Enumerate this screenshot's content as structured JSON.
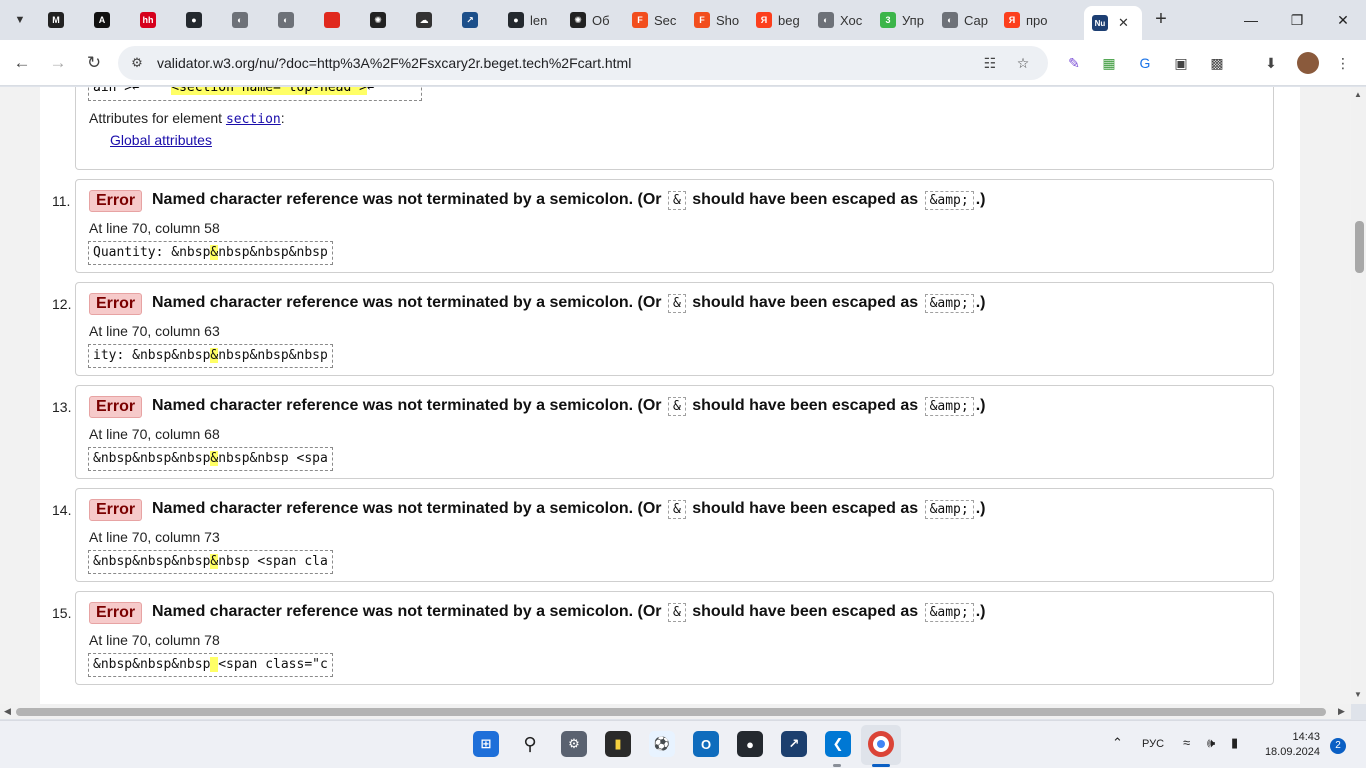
{
  "tabs": [
    {
      "title": "",
      "icon": "m-icon",
      "color": "#222222",
      "glyph": "M"
    },
    {
      "title": "",
      "icon": "a-icon",
      "color": "#111111",
      "glyph": "A"
    },
    {
      "title": "",
      "icon": "hh-icon",
      "color": "#d6001c",
      "glyph": "hh"
    },
    {
      "title": "",
      "icon": "github-icon",
      "color": "#24292f",
      "glyph": "●"
    },
    {
      "title": "",
      "icon": "globe-icon",
      "color": "#6d7178",
      "glyph": "◐"
    },
    {
      "title": "",
      "icon": "globe-icon",
      "color": "#6d7178",
      "glyph": "◐"
    },
    {
      "title": "",
      "icon": "red-square-icon",
      "color": "#e0291e",
      "glyph": ""
    },
    {
      "title": "",
      "icon": "openai-icon",
      "color": "#222222",
      "glyph": "✺"
    },
    {
      "title": "",
      "icon": "cloud-icon",
      "color": "#333333",
      "glyph": "☁"
    },
    {
      "title": "",
      "icon": "app-icon",
      "color": "#1c4f8a",
      "glyph": "↗"
    },
    {
      "title": "len",
      "icon": "github-icon",
      "color": "#24292f",
      "glyph": "●"
    },
    {
      "title": "Об",
      "icon": "openai-icon",
      "color": "#222222",
      "glyph": "✺"
    },
    {
      "title": "Sec",
      "icon": "figma-icon",
      "color": "#f24e1e",
      "glyph": "F"
    },
    {
      "title": "Sho",
      "icon": "figma-icon",
      "color": "#f24e1e",
      "glyph": "F"
    },
    {
      "title": "beg",
      "icon": "yandex-icon",
      "color": "#fc3f1d",
      "glyph": "Я"
    },
    {
      "title": "Хос",
      "icon": "globe-icon",
      "color": "#6d7178",
      "glyph": "◐"
    },
    {
      "title": "Упр",
      "icon": "green-icon",
      "color": "#3cb54a",
      "glyph": "3"
    },
    {
      "title": "Сар",
      "icon": "globe-icon",
      "color": "#6d7178",
      "glyph": "◐"
    },
    {
      "title": "про",
      "icon": "yandex-icon",
      "color": "#fc3f1d",
      "glyph": "Я"
    }
  ],
  "active_tab": {
    "icon": "w3c-icon",
    "glyph": "Nu"
  },
  "address": {
    "url": "validator.w3.org/nu/?doc=http%3A%2F%2Fsxcary2r.beget.tech%2Fcart.html"
  },
  "partial": {
    "extract_before": "ain\">↩    ",
    "extract_highlight": "<section name=\"top-head\">",
    "extract_after": "↩",
    "attr_prefix": "Attributes for element",
    "attr_element": "section",
    "attr_suffix": ":",
    "global_link": "Global attributes"
  },
  "messages": [
    {
      "num": "11.",
      "type": "Error",
      "pre": "Named character reference was not terminated by a semicolon. (Or",
      "code1": "&",
      "mid": "should have been escaped as",
      "code2": "&amp;",
      "post": ".)",
      "location": "At line 70, column 58",
      "ext_before": "Quantity: &nbsp",
      "ext_hl": "&",
      "ext_after": "nbsp&nbsp&nbsp"
    },
    {
      "num": "12.",
      "type": "Error",
      "pre": "Named character reference was not terminated by a semicolon. (Or",
      "code1": "&",
      "mid": "should have been escaped as",
      "code2": "&amp;",
      "post": ".)",
      "location": "At line 70, column 63",
      "ext_before": "ity: &nbsp&nbsp",
      "ext_hl": "&",
      "ext_after": "nbsp&nbsp&nbsp"
    },
    {
      "num": "13.",
      "type": "Error",
      "pre": "Named character reference was not terminated by a semicolon. (Or",
      "code1": "&",
      "mid": "should have been escaped as",
      "code2": "&amp;",
      "post": ".)",
      "location": "At line 70, column 68",
      "ext_before": "&nbsp&nbsp&nbsp",
      "ext_hl": "&",
      "ext_after": "nbsp&nbsp <spa"
    },
    {
      "num": "14.",
      "type": "Error",
      "pre": "Named character reference was not terminated by a semicolon. (Or",
      "code1": "&",
      "mid": "should have been escaped as",
      "code2": "&amp;",
      "post": ".)",
      "location": "At line 70, column 73",
      "ext_before": "&nbsp&nbsp&nbsp",
      "ext_hl": "&",
      "ext_after": "nbsp <span cla"
    },
    {
      "num": "15.",
      "type": "Error",
      "pre": "Named character reference was not terminated by a semicolon. (Or",
      "code1": "&",
      "mid": "should have been escaped as",
      "code2": "&amp;",
      "post": ".)",
      "location": "At line 70, column 78",
      "ext_before": "&nbsp&nbsp&nbsp",
      "ext_hl": " ",
      "ext_after": "<span class=\"c"
    }
  ],
  "taskbar": {
    "language": "РУС",
    "time": "14:43",
    "date": "18.09.2024",
    "notifications": "2"
  },
  "colors": {
    "error_badge_bg": "#f6caca",
    "highlight": "#ffff66",
    "link": "#1a0dab",
    "tabstrip_bg": "#dfe3ea"
  }
}
